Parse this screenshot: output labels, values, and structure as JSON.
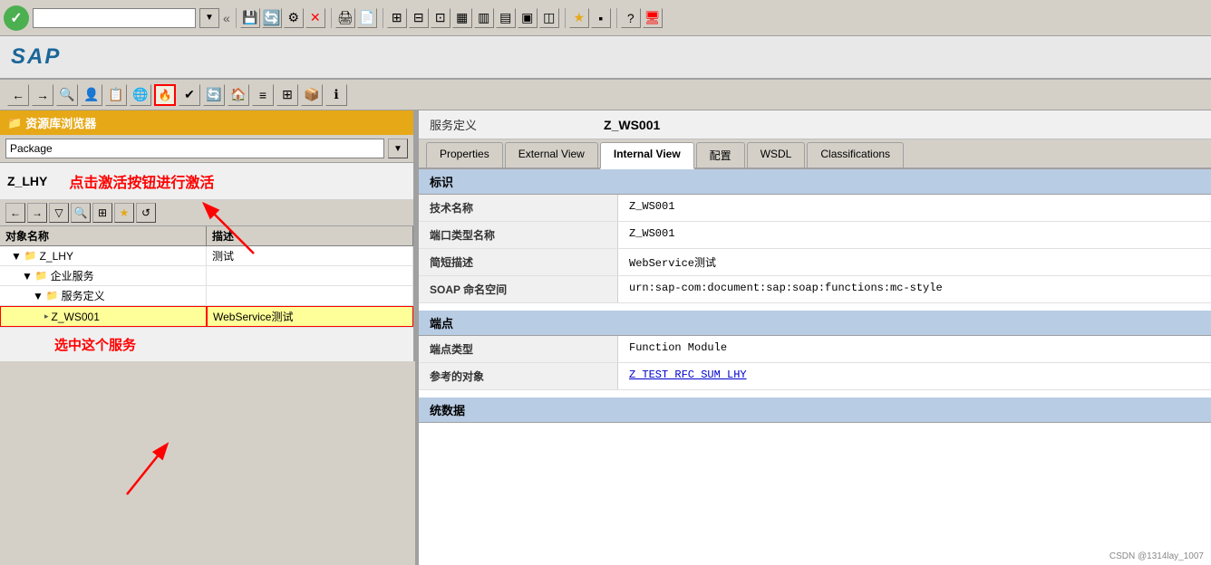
{
  "systemBar": {
    "inputPlaceholder": "",
    "navBack": "◀",
    "navForward": "▶",
    "navSeparator": "«"
  },
  "sapLogo": "SAP",
  "toolbar": {
    "icons": [
      "←",
      "→",
      "⌂",
      "🔍",
      "📋",
      "🌐",
      "📊",
      "📈",
      "📁",
      "🖂",
      "⭐",
      "📎",
      "🔧",
      "?",
      "🖥"
    ]
  },
  "leftPanel": {
    "header": "资源库浏览器",
    "packageLabel": "Package",
    "zlhy": "Z_LHY",
    "annotationActivate": "点击激活按钮进行激活",
    "annotationSelect": "选中这个服务",
    "treeColumns": [
      "对象名称",
      "描述"
    ],
    "treeRows": [
      {
        "indent": 1,
        "type": "folder",
        "expand": "▼",
        "name": "Z_LHY",
        "desc": "测试",
        "selected": false
      },
      {
        "indent": 2,
        "type": "folder",
        "expand": "▼",
        "name": "企业服务",
        "desc": "",
        "selected": false
      },
      {
        "indent": 3,
        "type": "folder",
        "expand": "▼",
        "name": "服务定义",
        "desc": "",
        "selected": false
      },
      {
        "indent": 4,
        "type": "item",
        "expand": "▸",
        "name": "Z_WS001",
        "desc": "WebService测试",
        "selected": true
      }
    ]
  },
  "rightPanel": {
    "serviceDefLabel": "服务定义",
    "serviceDefValue": "Z_WS001",
    "tabs": [
      {
        "id": "properties",
        "label": "Properties",
        "active": false
      },
      {
        "id": "external-view",
        "label": "External View",
        "active": false
      },
      {
        "id": "internal-view",
        "label": "Internal View",
        "active": true
      },
      {
        "id": "config",
        "label": "配置",
        "active": false
      },
      {
        "id": "wsdl",
        "label": "WSDL",
        "active": false
      },
      {
        "id": "classifications",
        "label": "Classifications",
        "active": false
      }
    ],
    "sections": [
      {
        "id": "identification",
        "header": "标识",
        "rows": [
          {
            "label": "技术名称",
            "value": "Z_WS001",
            "isLink": false
          },
          {
            "label": "端口类型名称",
            "value": "Z_WS001",
            "isLink": false
          },
          {
            "label": "简短描述",
            "value": "WebService测试",
            "isLink": false
          },
          {
            "label": "SOAP 命名空间",
            "value": "urn:sap-com:document:sap:soap:functions:mc-style",
            "isLink": false
          }
        ]
      },
      {
        "id": "endpoint",
        "header": "端点",
        "rows": [
          {
            "label": "端点类型",
            "value": "Function Module",
            "isLink": false
          },
          {
            "label": "参考的对象",
            "value": "Z TEST RFC SUM LHY",
            "isLink": true
          }
        ]
      },
      {
        "id": "params",
        "header": "统数据",
        "rows": []
      }
    ]
  },
  "watermark": "CSDN @1314lay_1007"
}
